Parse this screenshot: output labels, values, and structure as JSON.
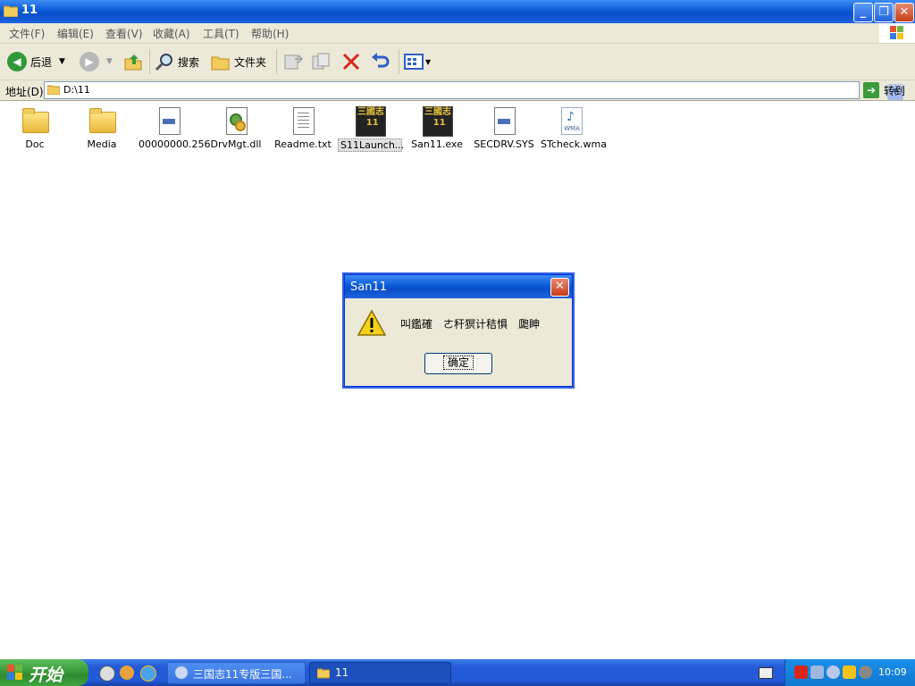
{
  "window": {
    "title": "11",
    "min_label": "_",
    "max_label": "❐",
    "close_label": "✕"
  },
  "menu": {
    "items": [
      "文件(F)",
      "编辑(E)",
      "查看(V)",
      "收藏(A)",
      "工具(T)",
      "帮助(H)"
    ]
  },
  "toolbar": {
    "back_label": "后退",
    "search_label": "搜索",
    "folders_label": "文件夹"
  },
  "address": {
    "label": "地址(D)",
    "path": "D:\\11",
    "go_label": "转到"
  },
  "files": [
    {
      "name": "Doc",
      "icon": "folder-icon"
    },
    {
      "name": "Media",
      "icon": "folder-icon"
    },
    {
      "name": "00000000.256",
      "icon": "generic-file-icon"
    },
    {
      "name": "DrvMgt.dll",
      "icon": "dll-icon"
    },
    {
      "name": "Readme.txt",
      "icon": "text-file-icon"
    },
    {
      "name": "S11Launch...",
      "icon": "game-exe-icon"
    },
    {
      "name": "San11.exe",
      "icon": "game-exe-icon"
    },
    {
      "name": "SECDRV.SYS",
      "icon": "generic-file-icon"
    },
    {
      "name": "STcheck.wma",
      "icon": "wma-icon"
    }
  ],
  "dialog": {
    "title": "San11",
    "message": "叫鑑確　ㄜ秆猽计秸惧　瓟眒",
    "ok_label": "确定"
  },
  "taskbar": {
    "start_label": "开始",
    "tasks": [
      {
        "label": "三国志11专版三国..."
      },
      {
        "label": "11"
      }
    ],
    "clock": "10:09"
  },
  "colors": {
    "titlebar": "#0a5ad6",
    "start_button": "#3a9a3a",
    "menubar": "#ece9d8"
  }
}
